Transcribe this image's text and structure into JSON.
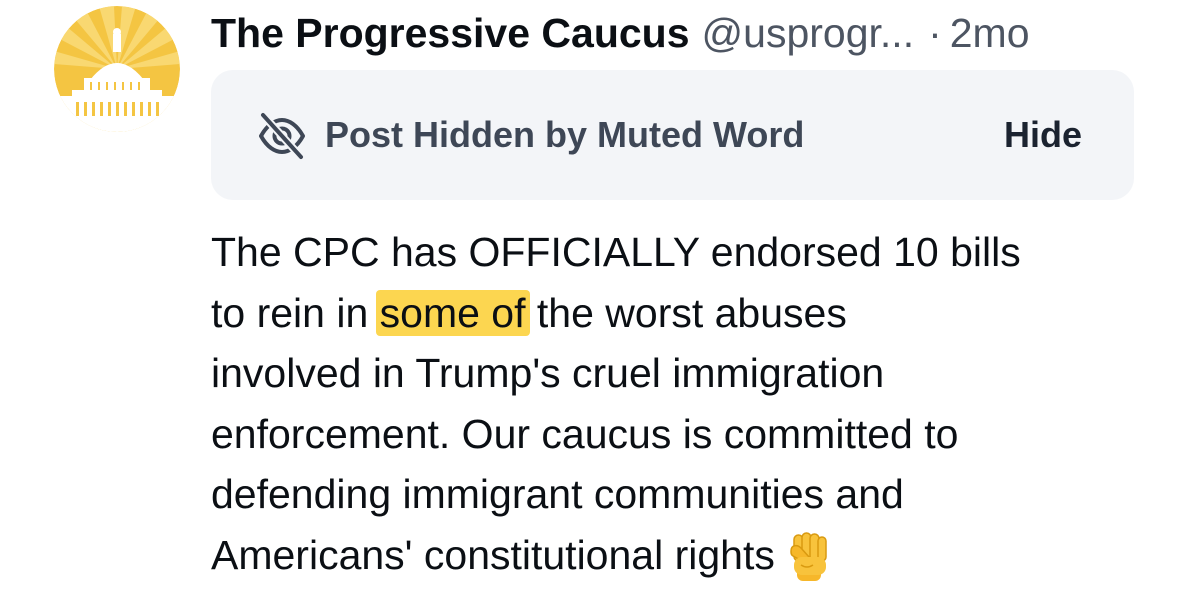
{
  "post": {
    "author": {
      "display_name": "The Progressive Caucus",
      "handle": "@usprogr...",
      "separator": "·",
      "time": "2mo"
    },
    "mute_notice": {
      "label": "Post Hidden by Muted Word",
      "hide_label": "Hide",
      "icon": "eye-slash-icon"
    },
    "text_lines": [
      [
        "The CPC has OFFICIALLY endorsed 10 bills"
      ],
      [
        "to rein in ",
        "some of",
        " the worst abuses"
      ],
      [
        "involved in Trump's cruel immigration"
      ],
      [
        "enforcement. Our caucus is committed to"
      ],
      [
        "defending immigrant communities and"
      ],
      [
        "Americans' constitutional rights"
      ]
    ],
    "highlighted_phrase": "some of",
    "emoji": "raised-fist-emoji",
    "colors": {
      "highlight": "#fcd650",
      "avatar_gold": "#f4c542",
      "muted_box_bg": "#f3f5f8",
      "secondary_text": "#4d5562"
    }
  }
}
